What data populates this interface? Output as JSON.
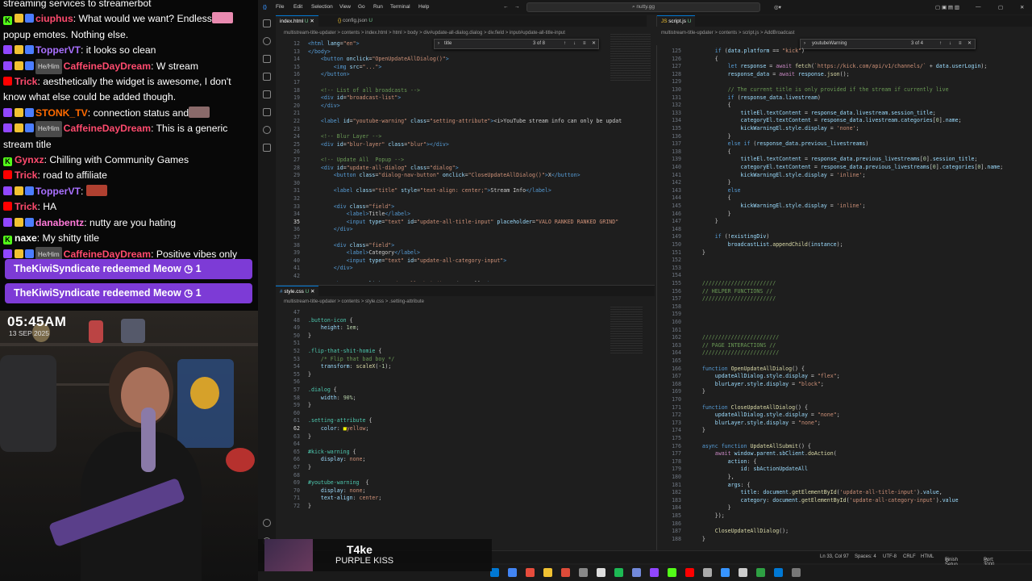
{
  "chat": {
    "header_text": "streaming services to streamerbot",
    "messages": [
      {
        "platform": "kick",
        "user": "ciuphus",
        "color": "#ff4b6e",
        "text": ": What would we want? Endless",
        "text2": "popup emotes. Nothing else.",
        "badges": [
          "crown-badge",
          "sub-badge"
        ]
      },
      {
        "platform": "twitch",
        "user": "TopperVT",
        "color": "#a970ff",
        "text": ": it looks so clean",
        "badges": [
          "gift-badge",
          "sub-badge"
        ]
      },
      {
        "platform": "twitch",
        "user": "CaffeineDayDream",
        "color": "#ff4b6e",
        "pronoun": "He/Him",
        "text": ": W stream",
        "badges": [
          "mod-badge",
          "sub-badge"
        ]
      },
      {
        "platform": "youtube",
        "user": "Trick",
        "color": "#ff4b6e",
        "text": ": aesthetically the widget is awesome, I don't know what else could be added though.",
        "badges": []
      },
      {
        "platform": "twitch",
        "user": "STONK_TV",
        "color": "#ff6a00",
        "text": ": connection status and",
        "badges": [
          "gift-badge",
          "sub-badge"
        ]
      },
      {
        "platform": "twitch",
        "user": "CaffeineDayDream",
        "color": "#ff4b6e",
        "pronoun": "He/Him",
        "text": ": This is a generic stream title",
        "badges": [
          "mod-badge",
          "sub-badge"
        ]
      },
      {
        "platform": "kick",
        "user": "Gynxz",
        "color": "#ff4b6e",
        "text": ": Chilling with Community Games",
        "badges": []
      },
      {
        "platform": "youtube",
        "user": "Trick",
        "color": "#ff4b6e",
        "text": ": road to affiliate",
        "badges": []
      },
      {
        "platform": "twitch",
        "user": "TopperVT",
        "color": "#a970ff",
        "text": ": ",
        "badges": [
          "gift-badge",
          "sub-badge"
        ]
      },
      {
        "platform": "youtube",
        "user": "Trick",
        "color": "#ff4b6e",
        "text": ": HA",
        "badges": []
      },
      {
        "platform": "twitch",
        "user": "danabentz",
        "color": "#ff7ad9",
        "text": ": nutty are you hating",
        "badges": [
          "gift-badge",
          "shield-badge"
        ]
      },
      {
        "platform": "kick",
        "user": "naxe",
        "color": "#ffffff",
        "text": ": My shitty title",
        "badges": []
      },
      {
        "platform": "twitch",
        "user": "CaffeineDayDream",
        "color": "#ff4b6e",
        "pronoun": "He/Him",
        "text": ": Positive vibes only",
        "badges": [
          "mod-badge",
          "sub-badge"
        ]
      }
    ],
    "redeems": [
      "TheKiwiSyndicate redeemed Meow",
      "TheKiwiSyndicate redeemed Meow"
    ],
    "redeem_count": "1"
  },
  "overlay": {
    "time": "05:45AM",
    "date": "13 SEP 2025",
    "track": "T4ke",
    "artist": "PURPLE KISS"
  },
  "vscode": {
    "menu": [
      "File",
      "Edit",
      "Selection",
      "View",
      "Go",
      "Run",
      "Terminal",
      "Help"
    ],
    "command_center": "nutty.gg",
    "left_tabs": [
      {
        "label": "index.html",
        "mod": "U",
        "active": true
      },
      {
        "label": "config.json",
        "mod": "U",
        "active": false
      }
    ],
    "right_tabs": [
      {
        "label": "script.js",
        "mod": "U",
        "active": true
      }
    ],
    "bottom_tabs": [
      {
        "label": "style.css",
        "mod": "U",
        "active": true
      }
    ],
    "left_breadcrumb": "multistream-title-updater > contents > index.html > html > body > div#update-all-dialog.dialog > div.field > input#update-all-title-input",
    "right_breadcrumb": "multistream-title-updater > contents > script.js > AddBroadcast",
    "bottom_breadcrumb": "multistream-title-updater > contents > style.css > .setting-attribute",
    "find_left": {
      "query": "title",
      "result": "3 of 8"
    },
    "find_right": {
      "query": "youtubeWarning",
      "result": "3 of 4"
    },
    "status": {
      "position": "Ln 33, Col 97",
      "spaces": "Spaces: 4",
      "encoding": "UTF-8",
      "eol": "CRLF",
      "language": "HTML",
      "setup": "Finish Setup",
      "port": "Port: 3000"
    }
  }
}
